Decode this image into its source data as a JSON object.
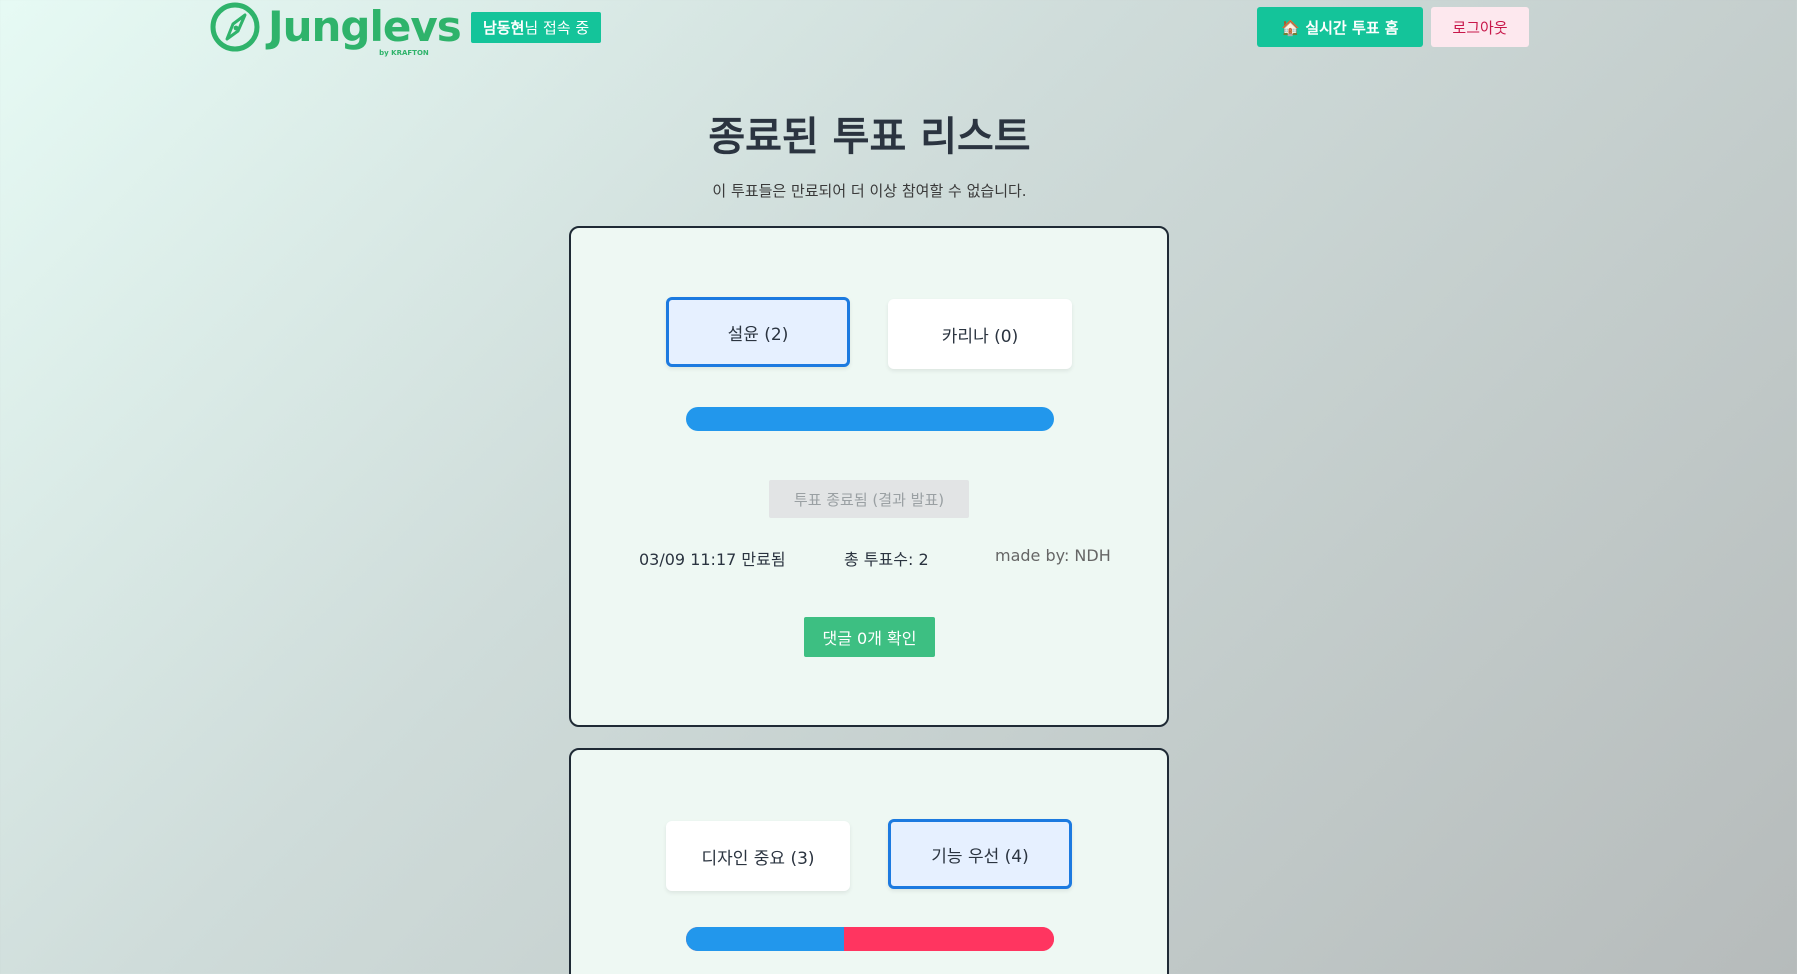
{
  "header": {
    "logo_text": "Jungl",
    "logo_text_b": "evs",
    "logo_sub": "by KRAFTON",
    "user_name": "남동현",
    "user_suffix": "님 접속 중",
    "home_button": "🏠 실시간 투표 홈",
    "logout_button": "로그아웃"
  },
  "page": {
    "title": "종료된 투표 리스트",
    "subtitle": "이 투표들은 만료되어 더 이상 참여할 수 없습니다."
  },
  "polls": [
    {
      "option_a": "설윤 (2)",
      "option_b": "카리나 (0)",
      "selected": "a",
      "votes_a": 2,
      "votes_b": 0,
      "status_button": "투표 종료됨 (결과 발표)",
      "expired": "03/09 11:17 만료됨",
      "total_votes": "총 투표수: 2",
      "author": "made by: NDH",
      "comment_button": "댓글 0개 확인"
    },
    {
      "option_a": "디자인 중요 (3)",
      "option_b": "기능 우선 (4)",
      "selected": "b",
      "votes_a": 3,
      "votes_b": 4
    }
  ],
  "colors": {
    "accent": "#14c49a",
    "bar_a": "#2297ec",
    "bar_b": "#ff3560",
    "selected_border": "#1c7ae0",
    "comment_button": "#3dbf82"
  }
}
